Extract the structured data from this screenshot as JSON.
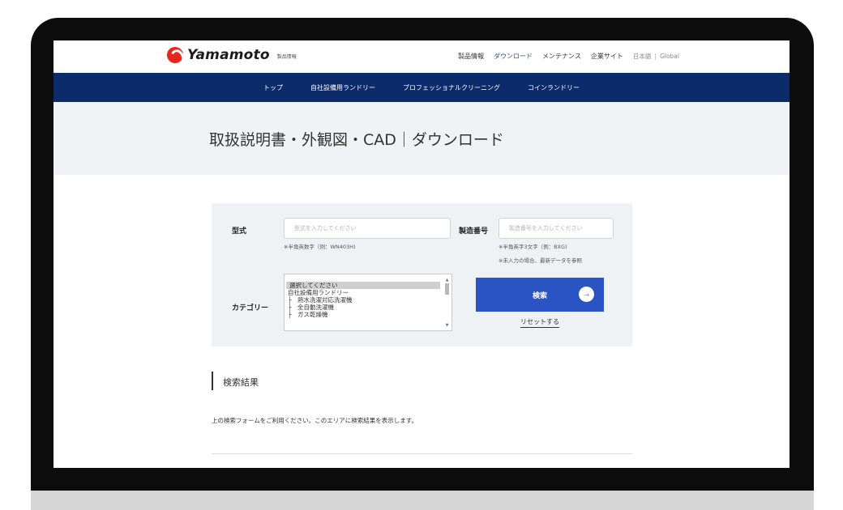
{
  "header": {
    "logo_text": "Yamamoto",
    "logo_sub": "製品情報",
    "nav": [
      "製品情報",
      "ダウンロード",
      "メンテナンス",
      "企業サイト"
    ],
    "lang_jp": "日本語",
    "lang_sep": "|",
    "lang_global": "Global"
  },
  "mainnav": [
    "トップ",
    "自社設備用ランドリー",
    "プロフェッショナルクリーニング",
    "コインランドリー"
  ],
  "page_title": "取扱説明書・外観図・CAD｜ダウンロード",
  "search": {
    "model_label": "型式",
    "model_placeholder": "型式を入力してください",
    "model_hint": "※半角英数字（例：WN403H)",
    "serial_label": "製造番号",
    "serial_placeholder": "製造番号を入力してください",
    "serial_hint1": "※半角英字3文字（例：BXG)",
    "serial_hint2": "※未入力の場合、最新データを参照",
    "category_label": "カテゴリー",
    "category_options": [
      "選択してください",
      "自社設備用ランドリー",
      "├　熱水洗濯対応洗濯機",
      "├　全自動洗濯機",
      "├　ガス乾燥機"
    ],
    "search_button": "検索",
    "reset_link": "リセットする"
  },
  "results": {
    "title": "検索結果",
    "message": "上の検索フォームをご利用ください。このエリアに検索結果を表示します。"
  },
  "colors": {
    "nav_bg": "#0c2b6b",
    "button_bg": "#2a53c3",
    "brand_red": "#e8261c",
    "panel_bg": "#eff2f5"
  }
}
